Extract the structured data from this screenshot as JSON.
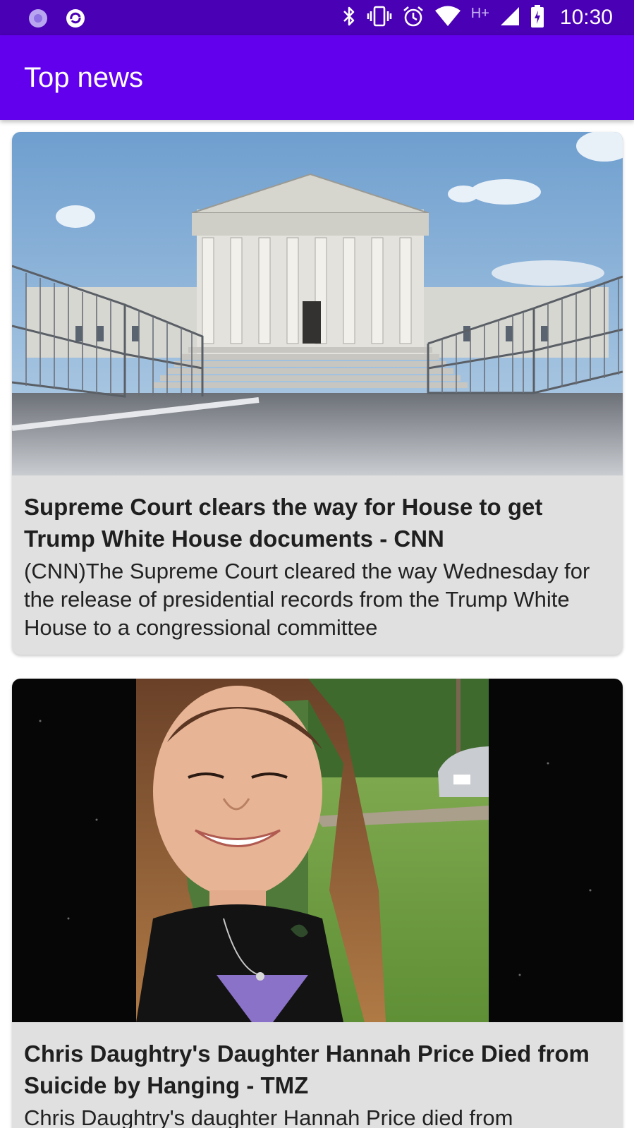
{
  "status_bar": {
    "network": "H+",
    "time": "10:30"
  },
  "app_bar": {
    "title": "Top news"
  },
  "articles": [
    {
      "title": "Supreme Court clears the way for House to get Trump White House documents - CNN",
      "description": "(CNN)The Supreme Court cleared the way Wednesday for the release of presidential records from the Trump White House to a congressional committee",
      "image_icon": "supreme-court-building-photo"
    },
    {
      "title": "Chris Daughtry's Daughter Hannah Price Died from Suicide by Hanging - TMZ",
      "description": "Chris Daughtry's daughter Hannah Price died from",
      "image_icon": "portrait-photo"
    }
  ],
  "colors": {
    "status_bar": "#4a00b4",
    "app_bar": "#6200ee",
    "card_background": "#e0e0e0"
  }
}
